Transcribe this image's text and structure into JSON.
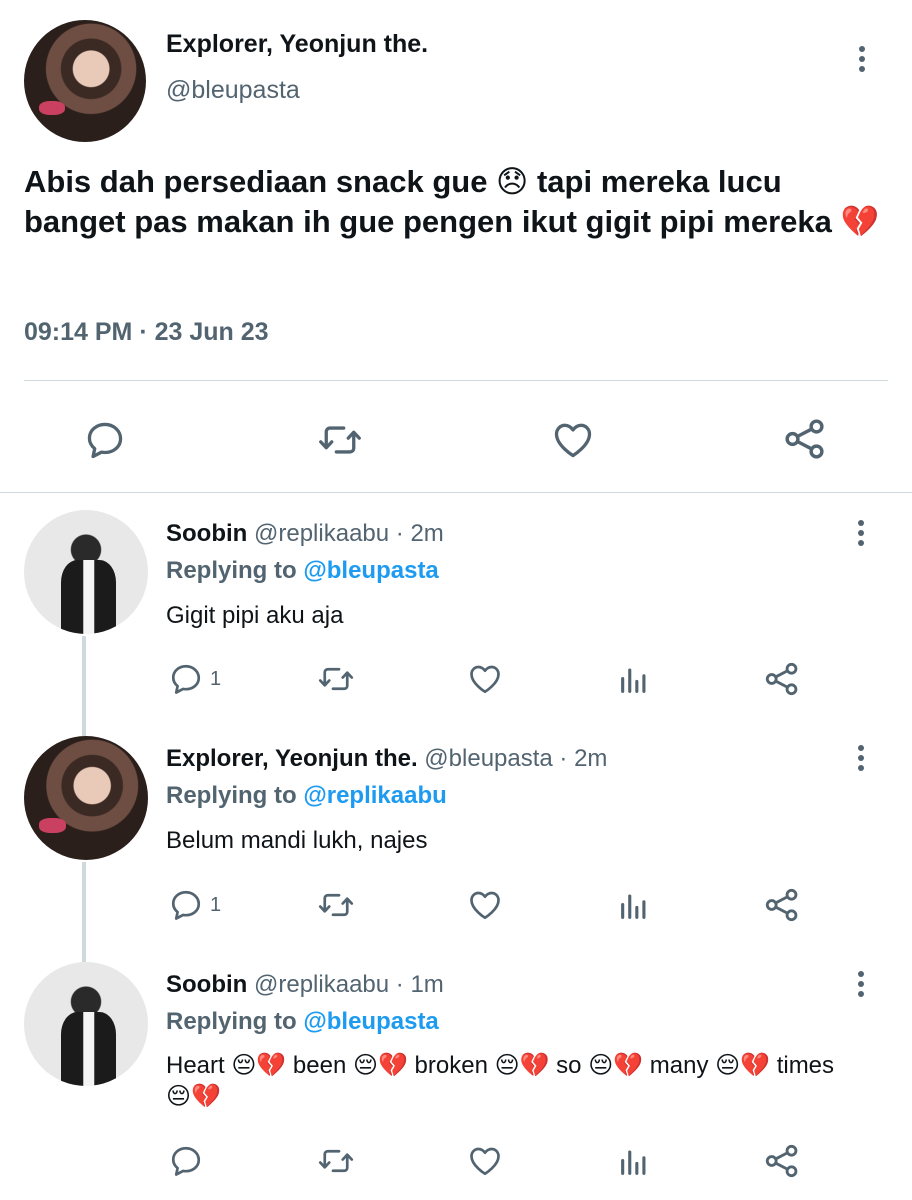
{
  "main_tweet": {
    "display_name": "Explorer, Yeonjun the.",
    "handle": "@bleupasta",
    "text": "Abis dah persediaan snack gue 😞 tapi mereka lucu banget pas makan ih gue pengen ikut gigit pipi mereka 💔",
    "time": "09:14 PM",
    "sep": " · ",
    "date": "23 Jun 23"
  },
  "replies": [
    {
      "display_name": "Soobin",
      "handle": "@replikaabu",
      "sep": " · ",
      "age": "2m",
      "replying_label": "Replying to",
      "replying_to": "@bleupasta",
      "text": "Gigit pipi aku aja",
      "reply_count": "1"
    },
    {
      "display_name": "Explorer, Yeonjun the.",
      "handle": "@bleupasta",
      "sep": " · ",
      "age": "2m",
      "replying_label": "Replying to",
      "replying_to": "@replikaabu",
      "text": "Belum mandi lukh, najes",
      "reply_count": "1"
    },
    {
      "display_name": "Soobin",
      "handle": "@replikaabu",
      "sep": " · ",
      "age": "1m",
      "replying_label": "Replying to",
      "replying_to": "@bleupasta",
      "text": "Heart 😔💔 been 😔💔 broken 😔💔 so 😔💔 many 😔💔 times 😔💔",
      "reply_count": ""
    }
  ],
  "icons": {
    "reply": "reply-icon",
    "retweet": "retweet-icon",
    "like": "like-icon",
    "analytics": "analytics-icon",
    "share": "share-icon",
    "more": "more-icon"
  },
  "colors": {
    "accent": "#1d9bf0",
    "secondary_text": "#536471",
    "divider": "#cfd9de"
  }
}
